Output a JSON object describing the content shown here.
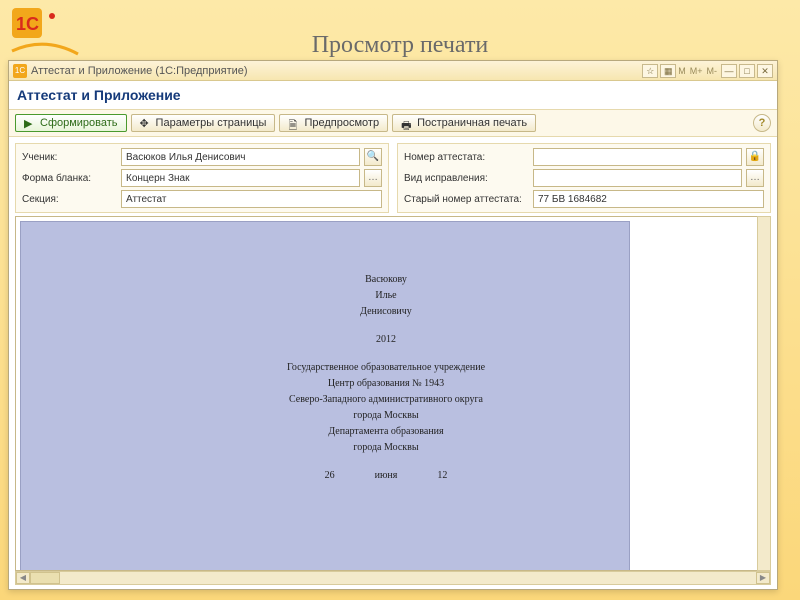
{
  "page_heading": "Просмотр печати",
  "titlebar": {
    "text": "Аттестат и Приложение  (1С:Предприятие)",
    "icons": {
      "star": "☆",
      "grid": "▦"
    },
    "m_buttons": [
      "M",
      "M+",
      "M-"
    ],
    "window_buttons": [
      "—",
      "□",
      "✕"
    ]
  },
  "form_title": "Аттестат и Приложение",
  "toolbar": {
    "generate": "Сформировать",
    "page_params": "Параметры страницы",
    "preview": "Предпросмотр",
    "paged_print": "Постраничная печать",
    "help": "?"
  },
  "fields_left": {
    "student_label": "Ученик:",
    "student_value": "Васюков Илья Денисович",
    "form_label": "Форма бланка:",
    "form_value": "Концерн Знак",
    "section_label": "Секция:",
    "section_value": "Аттестат"
  },
  "fields_right": {
    "attestat_number_label": "Номер аттестата:",
    "attestat_number_value": "",
    "correction_type_label": "Вид исправления:",
    "correction_type_value": "",
    "old_number_label": "Старый номер аттестата:",
    "old_number_value": "77 БВ 1684682"
  },
  "document": {
    "surname": "Васюкову",
    "name": "Илье",
    "patronymic": "Денисовичу",
    "year": "2012",
    "line1": "Государственное образовательное учреждение",
    "line2": "Центр образования № 1943",
    "line3": "Северо-Западного административного округа",
    "line4": "города Москвы",
    "line5": "Департамента образования",
    "line6": "города Москвы",
    "day": "26",
    "month": "июня",
    "yr_short": "12"
  },
  "glyphs": {
    "play": "▶",
    "arrows": "✥",
    "doc": "🗎",
    "printer": "🖶",
    "ellipsis": "…",
    "magnifier": "🔍",
    "lock": "🔒"
  }
}
